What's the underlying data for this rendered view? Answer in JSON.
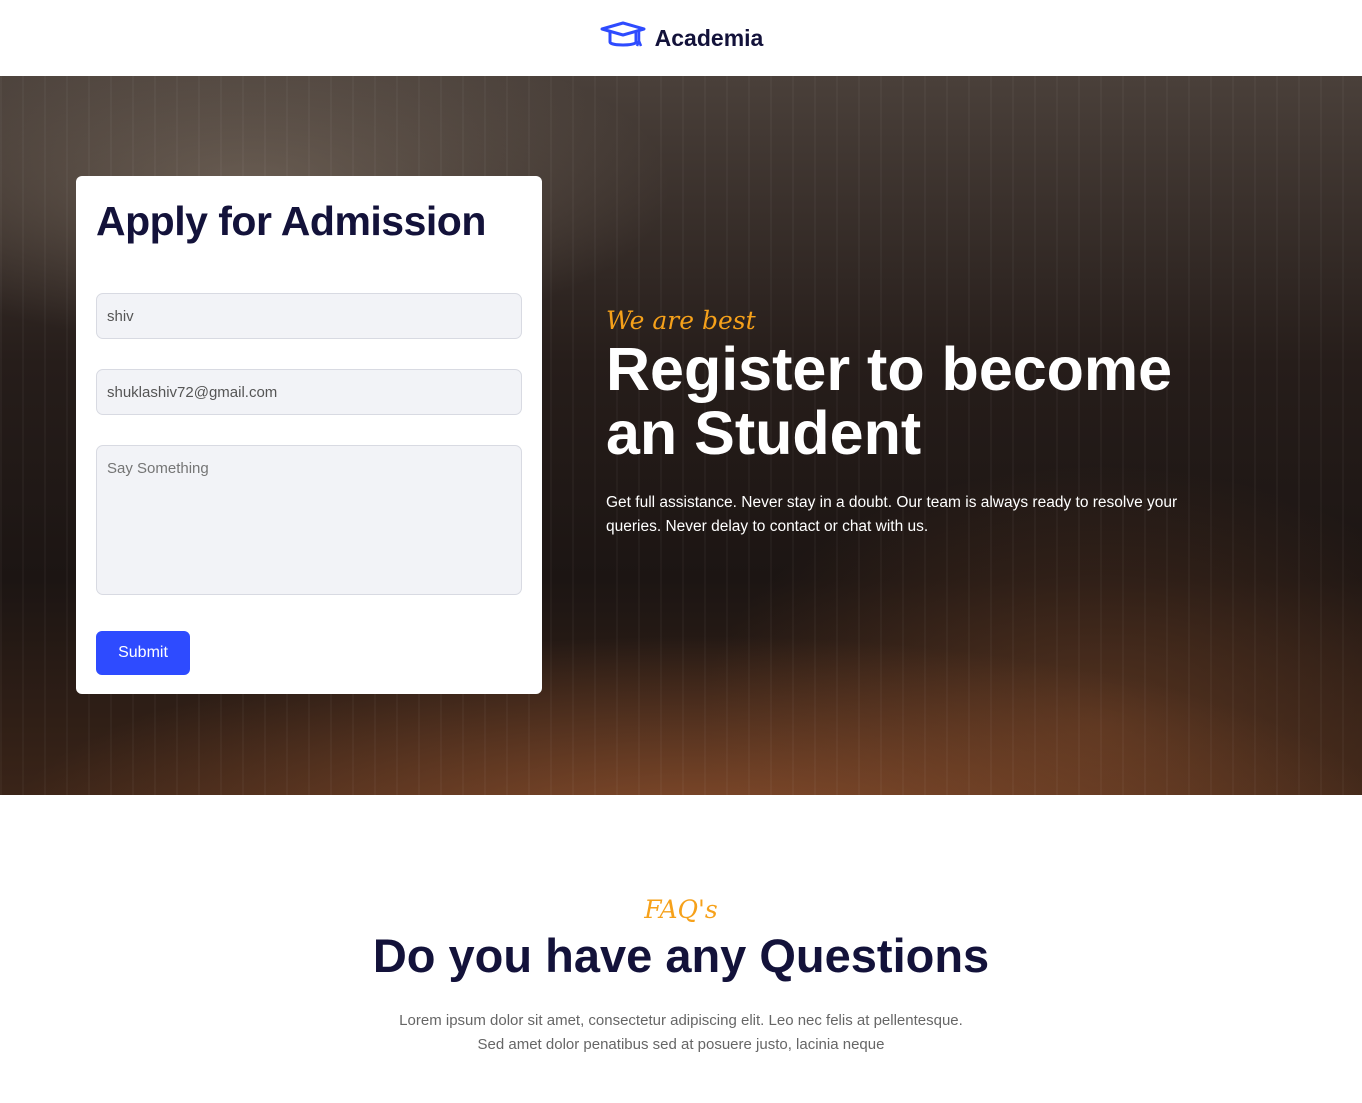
{
  "header": {
    "logo_text": "Academia",
    "logo_icon": "graduation-cap-icon",
    "brand_color": "#2e4bff"
  },
  "form": {
    "title": "Apply for Admission",
    "name_value": "shiv",
    "email_value": "shuklashiv72@gmail.com",
    "message_placeholder": "Say Something",
    "submit_label": "Submit"
  },
  "hero": {
    "tagline": "We are best",
    "title": "Register to become an Student",
    "description": "Get full assistance. Never stay in a doubt. Our team is always ready to resolve your queries. Never delay to contact or chat with us.",
    "accent_color": "#f6a11a"
  },
  "faq": {
    "tagline": "FAQ's",
    "title": "Do you have any Questions",
    "line1": "Lorem ipsum dolor sit amet, consectetur adipiscing elit. Leo nec felis at pellentesque.",
    "line2": "Sed amet dolor penatibus sed at posuere justo, lacinia neque"
  }
}
